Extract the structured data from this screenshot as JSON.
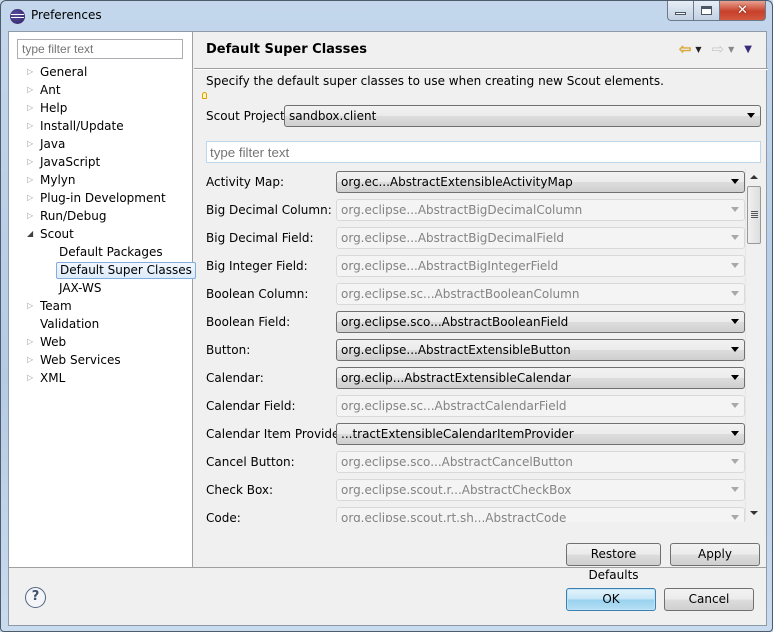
{
  "window": {
    "title": "Preferences",
    "controls": {
      "minimize": "minimize",
      "maximize": "maximize",
      "close": "✕"
    }
  },
  "sidebar": {
    "filter_placeholder": "type filter text",
    "items": [
      {
        "label": "General",
        "expander": "collapsed",
        "level": 0
      },
      {
        "label": "Ant",
        "expander": "collapsed",
        "level": 0
      },
      {
        "label": "Help",
        "expander": "collapsed",
        "level": 0
      },
      {
        "label": "Install/Update",
        "expander": "collapsed",
        "level": 0
      },
      {
        "label": "Java",
        "expander": "collapsed",
        "level": 0
      },
      {
        "label": "JavaScript",
        "expander": "collapsed",
        "level": 0
      },
      {
        "label": "Mylyn",
        "expander": "collapsed",
        "level": 0
      },
      {
        "label": "Plug-in Development",
        "expander": "collapsed",
        "level": 0
      },
      {
        "label": "Run/Debug",
        "expander": "collapsed",
        "level": 0
      },
      {
        "label": "Scout",
        "expander": "expanded",
        "level": 0
      },
      {
        "label": "Default Packages",
        "expander": "none",
        "level": 1
      },
      {
        "label": "Default Super Classes",
        "expander": "none",
        "level": 1,
        "selected": true
      },
      {
        "label": "JAX-WS",
        "expander": "none",
        "level": 1
      },
      {
        "label": "Team",
        "expander": "collapsed",
        "level": 0
      },
      {
        "label": "Validation",
        "expander": "none",
        "level": 0
      },
      {
        "label": "Web",
        "expander": "collapsed",
        "level": 0
      },
      {
        "label": "Web Services",
        "expander": "collapsed",
        "level": 0
      },
      {
        "label": "XML",
        "expander": "collapsed",
        "level": 0
      }
    ]
  },
  "page": {
    "title": "Default Super Classes",
    "nav": {
      "back": "⇦",
      "forward": "⇨",
      "dropdown": "▼",
      "menu": "▼"
    },
    "description": "Specify the default super classes to use when creating new Scout elements.",
    "project_label": "Scout Project:",
    "project_value": "sandbox.client",
    "filter_placeholder": "type filter text",
    "rows": [
      {
        "label": "Activity Map:",
        "value": "org.ec...AbstractExtensibleActivityMap",
        "enabled": true
      },
      {
        "label": "Big Decimal Column:",
        "value": "org.eclipse...AbstractBigDecimalColumn",
        "enabled": false
      },
      {
        "label": "Big Decimal Field:",
        "value": "org.eclipse...AbstractBigDecimalField",
        "enabled": false
      },
      {
        "label": "Big Integer Field:",
        "value": "org.eclipse...AbstractBigIntegerField",
        "enabled": false
      },
      {
        "label": "Boolean Column:",
        "value": "org.eclipse.sc...AbstractBooleanColumn",
        "enabled": false
      },
      {
        "label": "Boolean Field:",
        "value": "org.eclipse.sco...AbstractBooleanField",
        "enabled": true
      },
      {
        "label": "Button:",
        "value": "org.eclipse...AbstractExtensibleButton",
        "enabled": true
      },
      {
        "label": "Calendar:",
        "value": "org.eclip...AbstractExtensibleCalendar",
        "enabled": true
      },
      {
        "label": "Calendar Field:",
        "value": "org.eclipse.sc...AbstractCalendarField",
        "enabled": false
      },
      {
        "label": "Calendar Item Provider:",
        "value": "...tractExtensibleCalendarItemProvider",
        "enabled": true
      },
      {
        "label": "Cancel Button:",
        "value": "org.eclipse.sco...AbstractCancelButton",
        "enabled": false
      },
      {
        "label": "Check Box:",
        "value": "org.eclipse.scout.r...AbstractCheckBox",
        "enabled": false
      },
      {
        "label": "Code:",
        "value": "org.eclipse.scout.rt.sh...AbstractCode",
        "enabled": false
      }
    ],
    "restore_defaults_label": "Restore Defaults",
    "apply_label": "Apply"
  },
  "footer": {
    "help": "?",
    "ok_label": "OK",
    "cancel_label": "Cancel"
  }
}
